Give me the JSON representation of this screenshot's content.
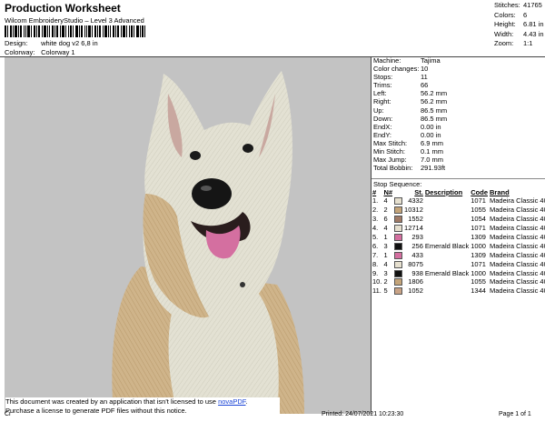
{
  "header": {
    "title": "Production Worksheet",
    "subtitle": "Wilcom EmbroideryStudio – Level 3 Advanced",
    "design_label": "Design:",
    "design_value": "white dog v2 6,8 in",
    "colorway_label": "Colorway:",
    "colorway_value": "Colorway 1"
  },
  "top_stats": [
    {
      "label": "Stitches:",
      "value": "41765"
    },
    {
      "label": "Colors:",
      "value": "6"
    },
    {
      "label": "Height:",
      "value": "6.81 in"
    },
    {
      "label": "Width:",
      "value": "4.43 in"
    },
    {
      "label": "Zoom:",
      "value": "1:1"
    }
  ],
  "machine_info": [
    {
      "label": "Machine:",
      "value": "Tajima"
    },
    {
      "label": "Color changes:",
      "value": "10"
    },
    {
      "label": "Stops:",
      "value": "11"
    },
    {
      "label": "Trims:",
      "value": "66"
    },
    {
      "label": "Left:",
      "value": "56.2 mm"
    },
    {
      "label": "Right:",
      "value": "56.2 mm"
    },
    {
      "label": "Up:",
      "value": "86.5 mm"
    },
    {
      "label": "Down:",
      "value": "86.5 mm"
    },
    {
      "label": "EndX:",
      "value": "0.00 in"
    },
    {
      "label": "EndY:",
      "value": "0.00 in"
    },
    {
      "label": "Max Stitch:",
      "value": "6.9 mm"
    },
    {
      "label": "Min Stitch:",
      "value": "0.1 mm"
    },
    {
      "label": "Max Jump:",
      "value": "7.0 mm"
    },
    {
      "label": "Total Bobbin:",
      "value": "291.93ft"
    }
  ],
  "stop_sequence": {
    "title": "Stop Sequence:",
    "headers": [
      "#",
      "N#",
      "St.",
      "Description",
      "Code",
      "Brand"
    ],
    "rows": [
      {
        "n": "1.",
        "nn": "4",
        "color": "#e6e0cf",
        "st": "4332",
        "desc": "",
        "code": "1071",
        "brand": "Madeira Classic 40"
      },
      {
        "n": "2.",
        "nn": "2",
        "color": "#c4a479",
        "st": "10312",
        "desc": "",
        "code": "1055",
        "brand": "Madeira Classic 40"
      },
      {
        "n": "3.",
        "nn": "6",
        "color": "#a07a66",
        "st": "1552",
        "desc": "",
        "code": "1054",
        "brand": "Madeira Classic 40"
      },
      {
        "n": "4.",
        "nn": "4",
        "color": "#e6e0cf",
        "st": "12714",
        "desc": "",
        "code": "1071",
        "brand": "Madeira Classic 40"
      },
      {
        "n": "5.",
        "nn": "1",
        "color": "#d46fa0",
        "st": "293",
        "desc": "",
        "code": "1309",
        "brand": "Madeira Classic 40"
      },
      {
        "n": "6.",
        "nn": "3",
        "color": "#111111",
        "st": "256",
        "desc": "Emerald Black",
        "code": "1000",
        "brand": "Madeira Classic 40"
      },
      {
        "n": "7.",
        "nn": "1",
        "color": "#d46fa0",
        "st": "433",
        "desc": "",
        "code": "1309",
        "brand": "Madeira Classic 40"
      },
      {
        "n": "8.",
        "nn": "4",
        "color": "#e6e0cf",
        "st": "8075",
        "desc": "",
        "code": "1071",
        "brand": "Madeira Classic 40"
      },
      {
        "n": "9.",
        "nn": "3",
        "color": "#111111",
        "st": "938",
        "desc": "Emerald Black",
        "code": "1000",
        "brand": "Madeira Classic 40"
      },
      {
        "n": "10.",
        "nn": "2",
        "color": "#c4a479",
        "st": "1806",
        "desc": "",
        "code": "1055",
        "brand": "Madeira Classic 40"
      },
      {
        "n": "11.",
        "nn": "5",
        "color": "#c9a386",
        "st": "1052",
        "desc": "",
        "code": "1344",
        "brand": "Madeira Classic 40"
      }
    ]
  },
  "notice": {
    "line1": "This document was created by an application that isn't licensed to use ",
    "link": "novaPDF",
    "line1_end": ".",
    "line2": "Purchase a license to generate PDF files without this notice."
  },
  "footer": {
    "left": "Cr",
    "printed": "Printed: 24/07/2021 10:23:30",
    "page": "Page 1 of 1"
  },
  "colors": {
    "canvas_bg": "#c3c3c3",
    "thread_cream": "#e6e0cf",
    "thread_tan": "#c4a479",
    "thread_pink": "#d46fa0"
  }
}
